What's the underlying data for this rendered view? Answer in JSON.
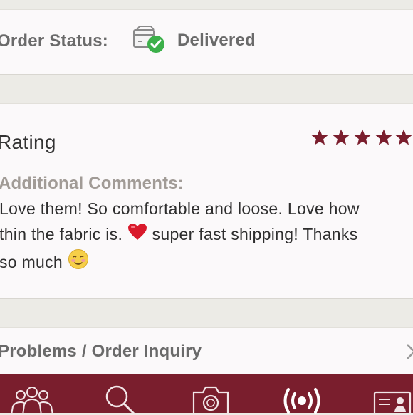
{
  "order_status": {
    "label": "Order Status:",
    "value": "Delivered",
    "icon": "delivered-box-icon"
  },
  "rating": {
    "title": "Rating",
    "stars": 5,
    "star_color": "#7a1e2d",
    "comments_label": "Additional Comments:",
    "comment_line1": "Love them! So comfortable and loose. Love how",
    "comment_line2_a": "thin the fabric is. ",
    "comment_line2_emoji": "red-heart-icon",
    "comment_line2_b": " super fast shipping! Thanks",
    "comment_line3_a": "so much ",
    "comment_line3_emoji": "smiling-face-icon"
  },
  "inquiry": {
    "label": "Problems / Order Inquiry"
  },
  "tabbar": {
    "background": "#7a1e2d",
    "tabs": [
      "community-icon",
      "search-icon",
      "camera-icon",
      "live-broadcast-icon",
      "profile-card-icon"
    ]
  }
}
